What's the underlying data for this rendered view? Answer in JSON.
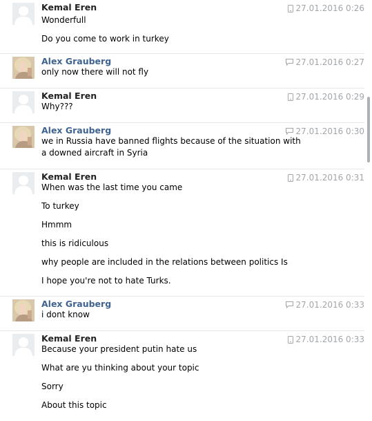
{
  "blocks": [
    {
      "sender": "Kemal Eren",
      "kind": "kemal",
      "avatar": "default-avatar",
      "status_icon": "phone-icon",
      "timestamp": "27.01.2016 0:26",
      "messages": [
        "Wonderfull",
        "Do you come to work in turkey"
      ]
    },
    {
      "sender": "Alex Grauberg",
      "kind": "alex",
      "avatar": "photo-avatar",
      "status_icon": "chat-bubble-icon",
      "timestamp": "27.01.2016 0:27",
      "messages": [
        "only now there will not fly"
      ]
    },
    {
      "sender": "Kemal Eren",
      "kind": "kemal",
      "avatar": "default-avatar",
      "status_icon": "phone-icon",
      "timestamp": "27.01.2016 0:29",
      "messages": [
        "Why???"
      ]
    },
    {
      "sender": "Alex Grauberg",
      "kind": "alex",
      "avatar": "photo-avatar",
      "status_icon": "chat-bubble-icon",
      "timestamp": "27.01.2016 0:30",
      "messages": [
        "we in Russia have banned flights because of the situation with a downed aircraft in Syria"
      ]
    },
    {
      "sender": "Kemal Eren",
      "kind": "kemal",
      "avatar": "default-avatar",
      "status_icon": "phone-icon",
      "timestamp": "27.01.2016 0:31",
      "messages": [
        "When was the last time you came",
        "To turkey",
        "Hmmm",
        "this is ridiculous",
        "why people are included in the relations between politics Is",
        "I hope you're not to hate Turks."
      ]
    },
    {
      "sender": "Alex Grauberg",
      "kind": "alex",
      "avatar": "photo-avatar",
      "status_icon": "chat-bubble-icon",
      "timestamp": "27.01.2016 0:33",
      "messages": [
        "i dont know"
      ]
    },
    {
      "sender": "Kemal Eren",
      "kind": "kemal",
      "avatar": "default-avatar",
      "status_icon": "phone-icon",
      "timestamp": "27.01.2016 0:33",
      "messages": [
        "Because your president putin hate us",
        "What are yu thinking about your topic",
        "Sorry",
        "About this topic"
      ]
    }
  ],
  "colors": {
    "kemal_name": "#222222",
    "alex_name": "#3f6391",
    "timestamp": "#a2a6ab",
    "separator": "#e4e8ed",
    "scrollbar": "#aab1b9"
  }
}
